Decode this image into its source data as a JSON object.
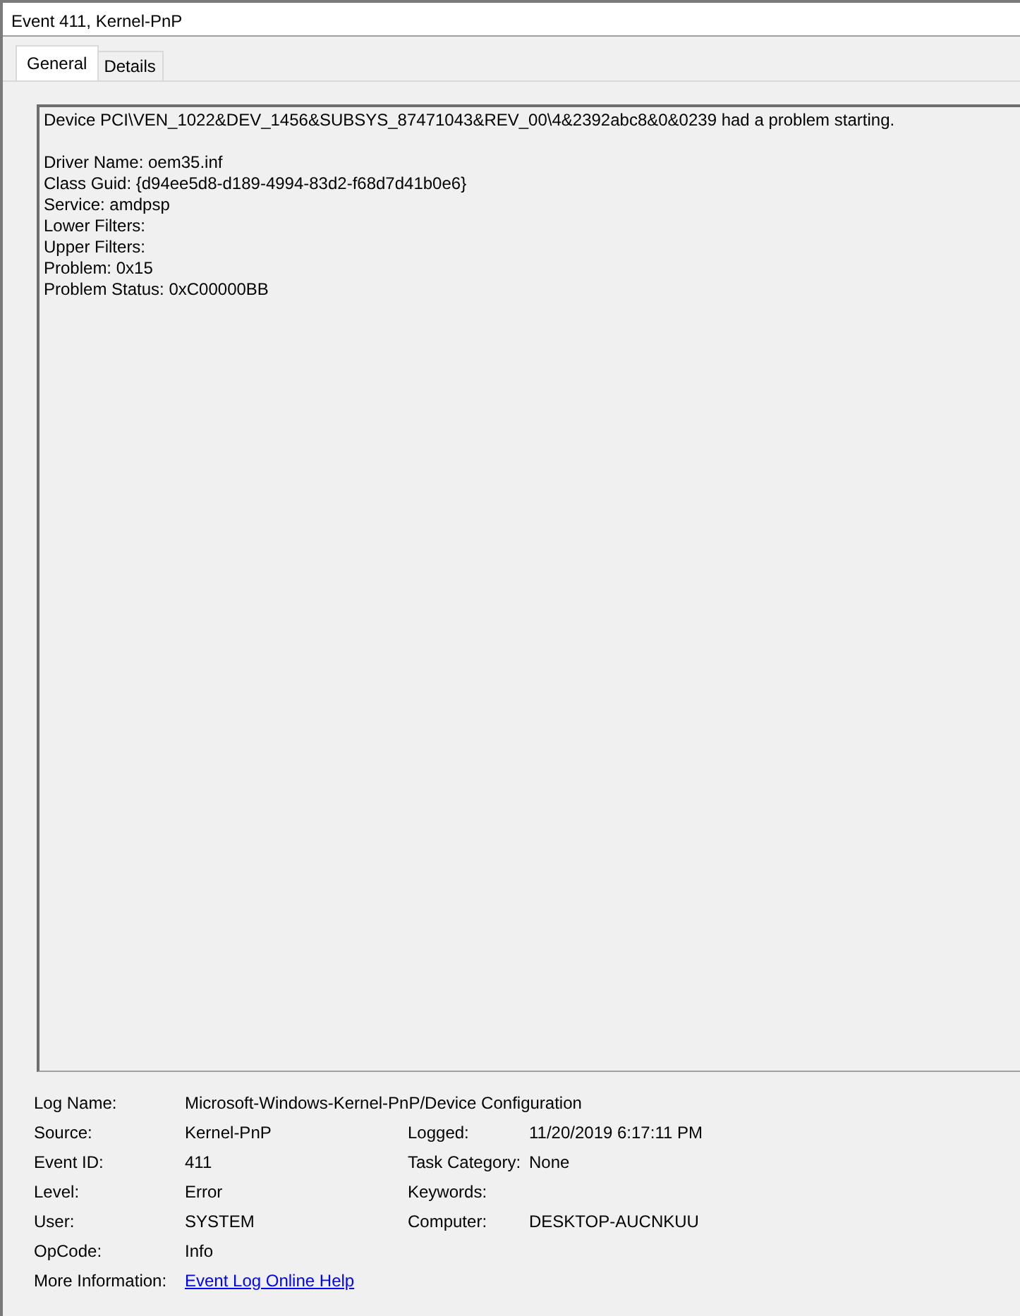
{
  "window": {
    "title": "Event 411, Kernel-PnP"
  },
  "tabs": [
    {
      "label": "General",
      "selected": true
    },
    {
      "label": "Details",
      "selected": false
    }
  ],
  "description": {
    "lines": [
      {
        "text": "Device PCI\\VEN_1022&DEV_1456&SUBSYS_87471043&REV_00\\4&2392abc8&0&0239 had a problem starting."
      },
      {
        "text": "Driver Name: oem35.inf",
        "gap_before": true
      },
      {
        "text": "Class Guid: {d94ee5d8-d189-4994-83d2-f68d7d41b0e6}"
      },
      {
        "text": "Service: amdpsp"
      },
      {
        "text": "Lower Filters:"
      },
      {
        "text": "Upper Filters:"
      },
      {
        "text": "Problem: 0x15"
      },
      {
        "text": "Problem Status: 0xC00000BB"
      }
    ]
  },
  "properties": [
    {
      "fields": [
        {
          "label": "Log Name:",
          "value": "Microsoft-Windows-Kernel-PnP/Device Configuration",
          "kind": "text"
        }
      ]
    },
    {
      "fields": [
        {
          "label": "Source:",
          "value": "Kernel-PnP",
          "kind": "text"
        },
        {
          "label": "Logged:",
          "value": "11/20/2019 6:17:11 PM",
          "kind": "text"
        }
      ]
    },
    {
      "fields": [
        {
          "label": "Event ID:",
          "value": "411",
          "kind": "text"
        },
        {
          "label": "Task Category:",
          "value": "None",
          "kind": "text"
        }
      ]
    },
    {
      "fields": [
        {
          "label": "Level:",
          "value": "Error",
          "kind": "text"
        },
        {
          "label": "Keywords:"
        }
      ]
    },
    {
      "fields": [
        {
          "label": "User:",
          "value": "SYSTEM",
          "kind": "text"
        },
        {
          "label": "Computer:",
          "value": "DESKTOP-AUCNKUU",
          "kind": "text"
        }
      ]
    },
    {
      "fields": [
        {
          "label": "OpCode:",
          "value": "Info",
          "kind": "text"
        }
      ]
    },
    {
      "fields": [
        {
          "label": "More Information:",
          "value": "Event Log Online Help",
          "kind": "link"
        }
      ]
    }
  ]
}
